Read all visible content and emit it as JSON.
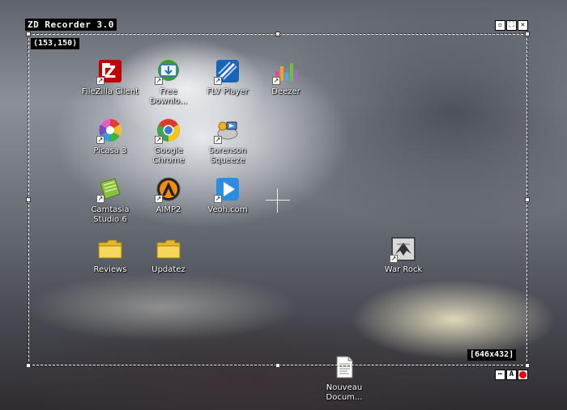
{
  "recorder": {
    "title": "ZD Recorder 3.0",
    "coords": "(153,150)",
    "size": "[646x432]",
    "buttons": {
      "options": "⋯",
      "audio": "A"
    },
    "accent_color": "#e00000"
  },
  "desktop": {
    "icons": {
      "filezilla": {
        "label": "FileZilla Client",
        "icon": "filezilla-icon"
      },
      "free_download": {
        "label": "Free\nDownlo...",
        "icon": "download-manager-icon"
      },
      "flv_player": {
        "label": "FLV Player",
        "icon": "flv-player-icon"
      },
      "deezer": {
        "label": "Deezer",
        "icon": "deezer-icon"
      },
      "picasa": {
        "label": "Picasa 3",
        "icon": "picasa-icon"
      },
      "chrome": {
        "label": "Google\nChrome",
        "icon": "chrome-icon"
      },
      "sorenson": {
        "label": "Sorenson\nSqueeze",
        "icon": "sorenson-icon"
      },
      "camtasia": {
        "label": "Camtasia\nStudio 6",
        "icon": "camtasia-icon"
      },
      "aimp": {
        "label": "AIMP2",
        "icon": "aimp-icon"
      },
      "veoh": {
        "label": "Veoh.com",
        "icon": "veoh-icon"
      },
      "reviews": {
        "label": "Reviews",
        "icon": "folder-icon"
      },
      "updatez": {
        "label": "Updatez",
        "icon": "folder-icon"
      },
      "warrock": {
        "label": "War Rock",
        "icon": "war-rock-icon"
      },
      "nouveau": {
        "label": "Nouveau\nDocum...",
        "icon": "text-document-icon"
      }
    }
  }
}
